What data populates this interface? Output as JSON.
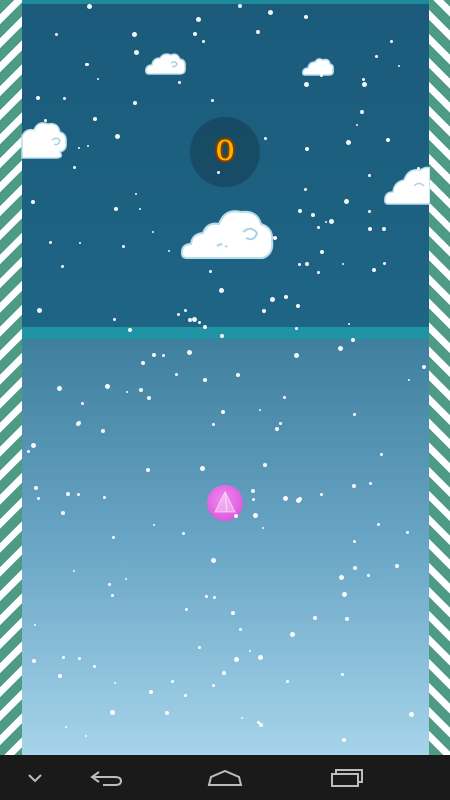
{
  "hud": {
    "score": "0"
  },
  "colors": {
    "sky_top": "#1b5a7a",
    "sky_bottom": "#a6d4ea",
    "divider": "#1f94a4",
    "wall_stripe": "#4d9a85",
    "player": "#e05ae0",
    "score": "#f5b400"
  },
  "icons": {
    "player": "pink-triangle-ball-icon",
    "score_badge": "score-circle",
    "nav_back": "back-arrow-icon",
    "nav_home": "home-icon",
    "nav_recent": "recent-apps-icon",
    "nav_hide": "chevron-down-icon"
  }
}
